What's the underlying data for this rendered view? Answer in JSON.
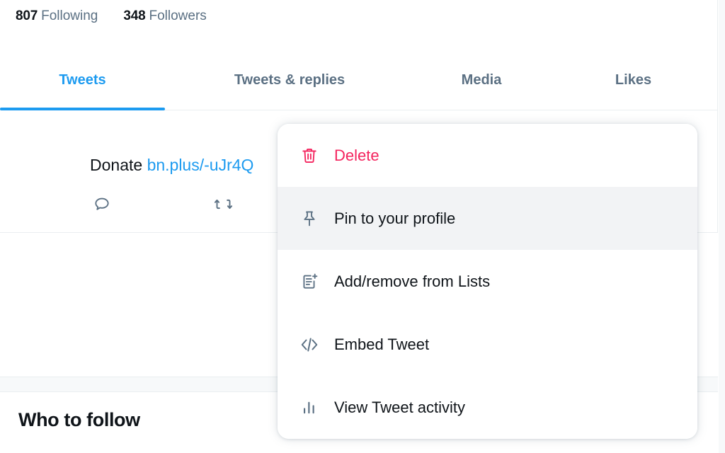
{
  "profile_stats": [
    {
      "count": "807",
      "label": "Following",
      "name": "following-stat"
    },
    {
      "count": "348",
      "label": "Followers",
      "name": "followers-stat"
    }
  ],
  "tabs": [
    {
      "label": "Tweets",
      "active": true
    },
    {
      "label": "Tweets & replies",
      "active": false
    },
    {
      "label": "Media",
      "active": false
    },
    {
      "label": "Likes",
      "active": false
    }
  ],
  "tweet": {
    "text": "Donate ",
    "link": "bn.plus/-uJr4Q",
    "reply_icon": "reply-icon",
    "retweet_icon": "retweet-icon"
  },
  "menu": {
    "items": [
      {
        "label": "Delete",
        "icon": "trash-icon",
        "danger": true,
        "hovered": false
      },
      {
        "label": "Pin to your profile",
        "icon": "pin-icon",
        "danger": false,
        "hovered": true
      },
      {
        "label": "Add/remove from Lists",
        "icon": "list-add-icon",
        "danger": false,
        "hovered": false
      },
      {
        "label": "Embed Tweet",
        "icon": "code-icon",
        "danger": false,
        "hovered": false
      },
      {
        "label": "View Tweet activity",
        "icon": "bar-chart-icon",
        "danger": false,
        "hovered": false
      }
    ]
  },
  "sidebar": {
    "who_to_follow_title": "Who to follow"
  },
  "colors": {
    "accent": "#1d9bf0",
    "danger": "#f4245e",
    "text": "#0f1419",
    "muted": "#5b7083",
    "divider": "#eaeef0",
    "hover_bg": "#f2f3f5",
    "band_bg": "#f7f9fa"
  }
}
